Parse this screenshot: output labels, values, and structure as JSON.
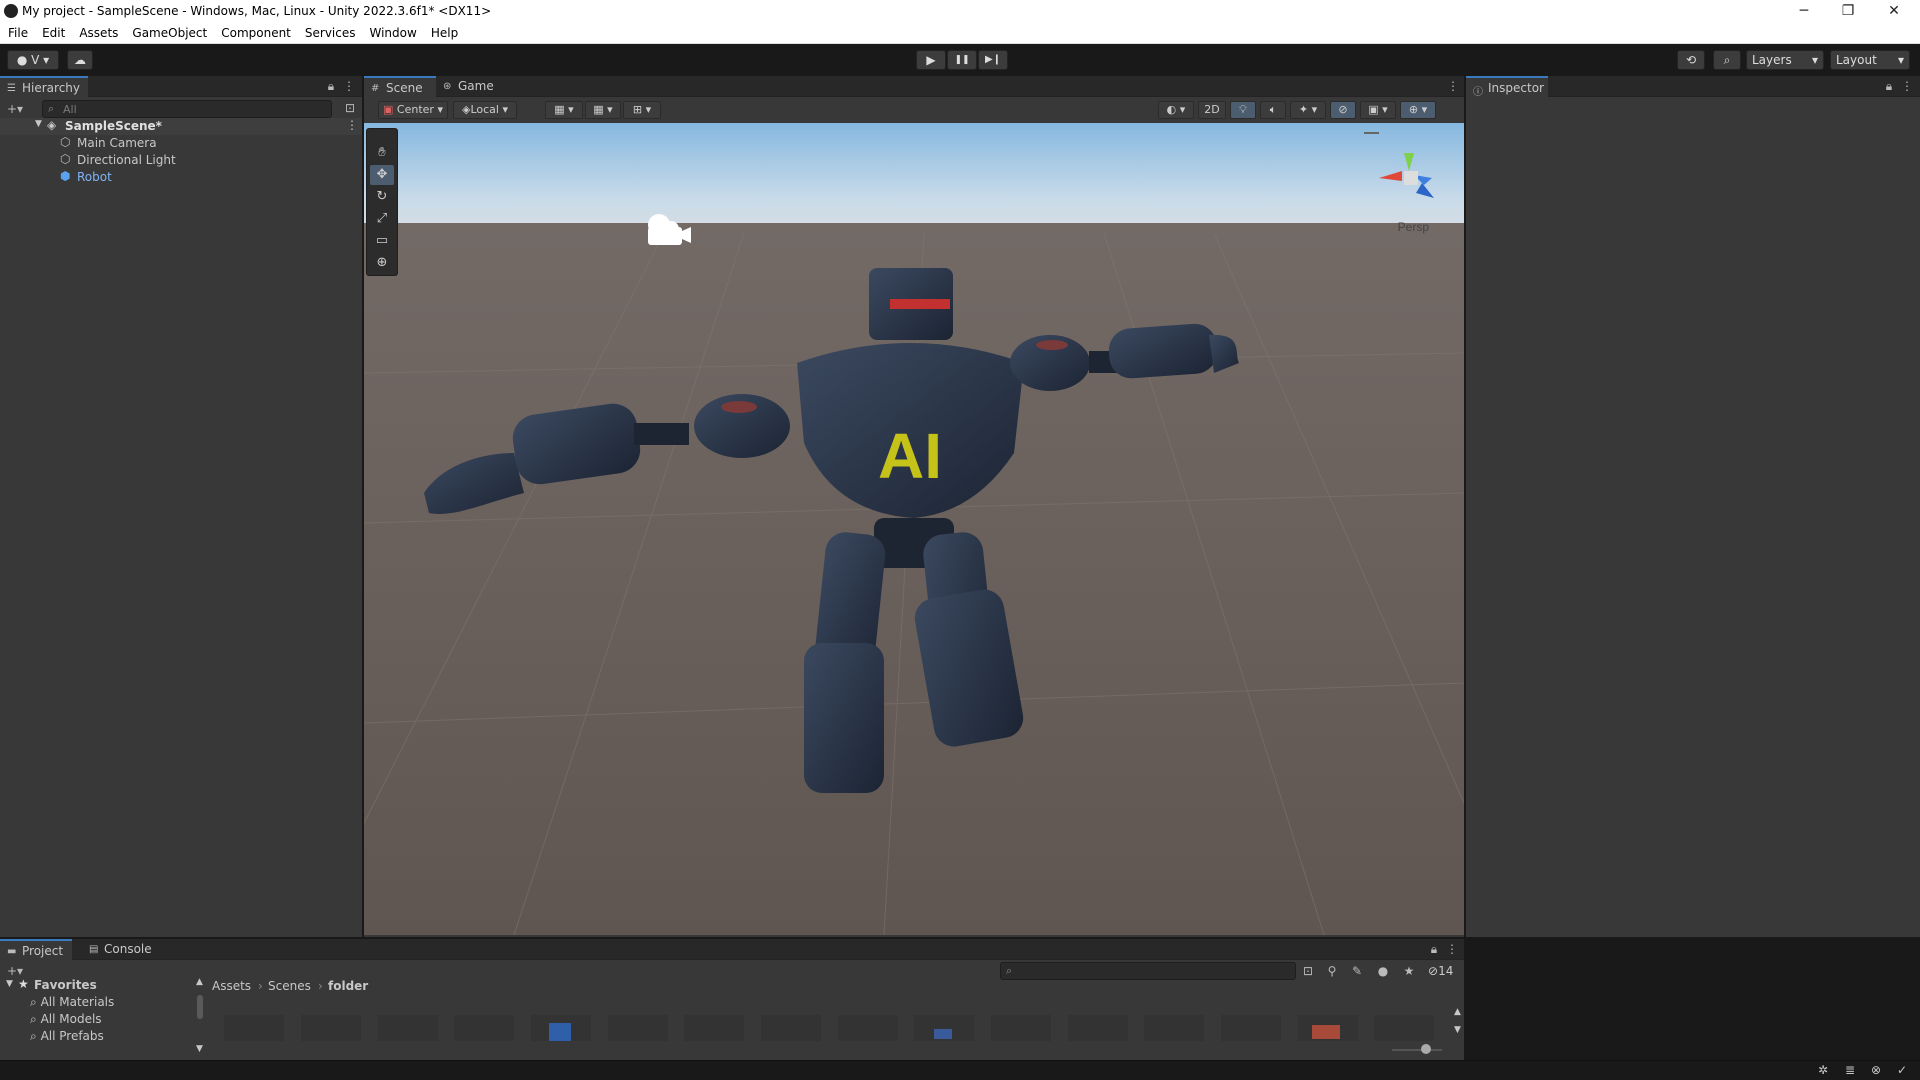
{
  "window": {
    "title": "My project - SampleScene - Windows, Mac, Linux - Unity 2022.3.6f1* <DX11>",
    "controls": {
      "minimize": "─",
      "restore": "❐",
      "close": "✕"
    }
  },
  "menu": [
    "File",
    "Edit",
    "Assets",
    "GameObject",
    "Component",
    "Services",
    "Window",
    "Help"
  ],
  "toolbar": {
    "account_label": "V",
    "play": "▶",
    "pause": "❚❚",
    "step": "▶❙",
    "layers_label": "Layers",
    "layout_label": "Layout"
  },
  "hierarchy": {
    "tab_label": "Hierarchy",
    "search_placeholder": "All",
    "scene_name": "SampleScene*",
    "items": [
      {
        "label": "Main Camera",
        "selected": false
      },
      {
        "label": "Directional Light",
        "selected": false
      },
      {
        "label": "Robot",
        "selected": true
      }
    ]
  },
  "scene_view": {
    "tabs": [
      "Scene",
      "Game"
    ],
    "pivot_label": "Center",
    "space_label": "Local",
    "mode_2d": "2D",
    "persp_label": "Persp",
    "chest_text": "AI"
  },
  "inspector": {
    "tab_label": "Inspector"
  },
  "project": {
    "tabs": [
      "Project",
      "Console"
    ],
    "favorites_label": "Favorites",
    "favorites": [
      "All Materials",
      "All Models",
      "All Prefabs"
    ],
    "breadcrumb": [
      "Assets",
      "Scenes",
      "folder"
    ],
    "hidden_count": "14"
  },
  "colors": {
    "accent": "#3a79bb",
    "selected_text": "#7fb3f5",
    "panel_bg": "#383838",
    "toolbar_bg": "#191919"
  }
}
